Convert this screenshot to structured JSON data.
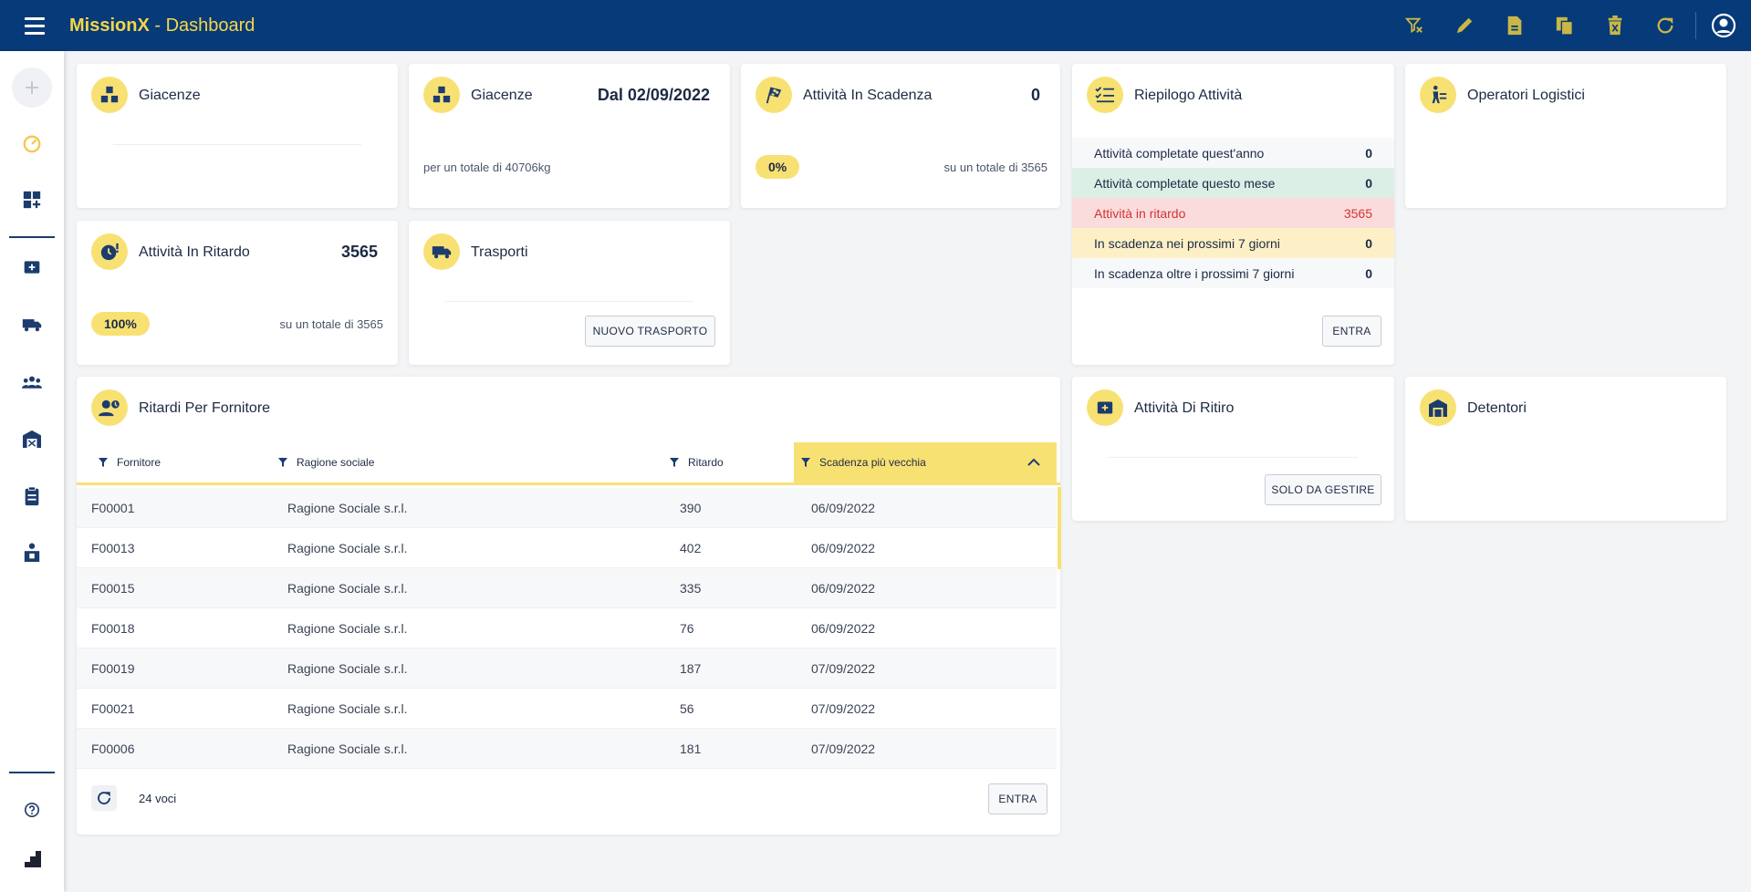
{
  "app": {
    "name": "MissionX",
    "separator": " - ",
    "section": "Dashboard"
  },
  "colors": {
    "topbar": "#063a78",
    "accent": "#f5d64a",
    "badge": "#f8e173",
    "late_row": "#fbdcdc",
    "late_text": "#d13434",
    "month_row": "#dcefe6",
    "soon_row": "#fdf0c6"
  },
  "toolbar_icons": [
    "filter-off-icon",
    "pencil-icon",
    "document-icon",
    "copy-icon",
    "delete-icon",
    "refresh-icon",
    "user-account-icon"
  ],
  "sidebar_icons": [
    "plus-icon",
    "dashboard-gauge-icon",
    "widgets-add-icon",
    "medical-box-icon",
    "truck-icon",
    "group-icon",
    "warehouse-icon",
    "clipboard-icon",
    "operator-box-icon",
    "help-icon",
    "brand-logo-icon"
  ],
  "cards": {
    "giacenze1": {
      "title": "Giacenze"
    },
    "giacenze2": {
      "title": "Giacenze",
      "value": "Dal 02/09/2022",
      "subtitle": "per un totale di 40706kg"
    },
    "scadenza": {
      "title": "Attività In Scadenza",
      "value": "0",
      "percent": "0%",
      "subtitle": "su un totale di 3565"
    },
    "riepilogo": {
      "title": "Riepilogo Attività",
      "rows": [
        {
          "label": "Attività completate quest'anno",
          "value": "0"
        },
        {
          "label": "Attività completate questo mese",
          "value": "0"
        },
        {
          "label": "Attività in ritardo",
          "value": "3565"
        },
        {
          "label": "In scadenza nei prossimi 7 giorni",
          "value": "0"
        },
        {
          "label": "In scadenza oltre i prossimi 7 giorni",
          "value": "0"
        }
      ],
      "button": "ENTRA"
    },
    "operatori": {
      "title": "Operatori Logistici"
    },
    "ritardo": {
      "title": "Attività In Ritardo",
      "value": "3565",
      "percent": "100%",
      "subtitle": "su un totale di 3565"
    },
    "trasporti": {
      "title": "Trasporti",
      "button": "NUOVO TRASPORTO"
    },
    "ritiro": {
      "title": "Attività Di Ritiro",
      "button": "SOLO DA GESTIRE"
    },
    "detentori": {
      "title": "Detentori"
    }
  },
  "ritardi": {
    "title": "Ritardi Per Fornitore",
    "columns": [
      "Fornitore",
      "Ragione sociale",
      "Ritardo",
      "Scadenza più vecchia"
    ],
    "rows": [
      [
        "F00001",
        "Ragione Sociale s.r.l.",
        "390",
        "06/09/2022"
      ],
      [
        "F00013",
        "Ragione Sociale s.r.l.",
        "402",
        "06/09/2022"
      ],
      [
        "F00015",
        "Ragione Sociale s.r.l.",
        "335",
        "06/09/2022"
      ],
      [
        "F00018",
        "Ragione Sociale s.r.l.",
        "76",
        "06/09/2022"
      ],
      [
        "F00019",
        "Ragione Sociale s.r.l.",
        "187",
        "07/09/2022"
      ],
      [
        "F00021",
        "Ragione Sociale s.r.l.",
        "56",
        "07/09/2022"
      ],
      [
        "F00006",
        "Ragione Sociale s.r.l.",
        "181",
        "07/09/2022"
      ]
    ],
    "count": "24 voci",
    "button": "ENTRA"
  }
}
